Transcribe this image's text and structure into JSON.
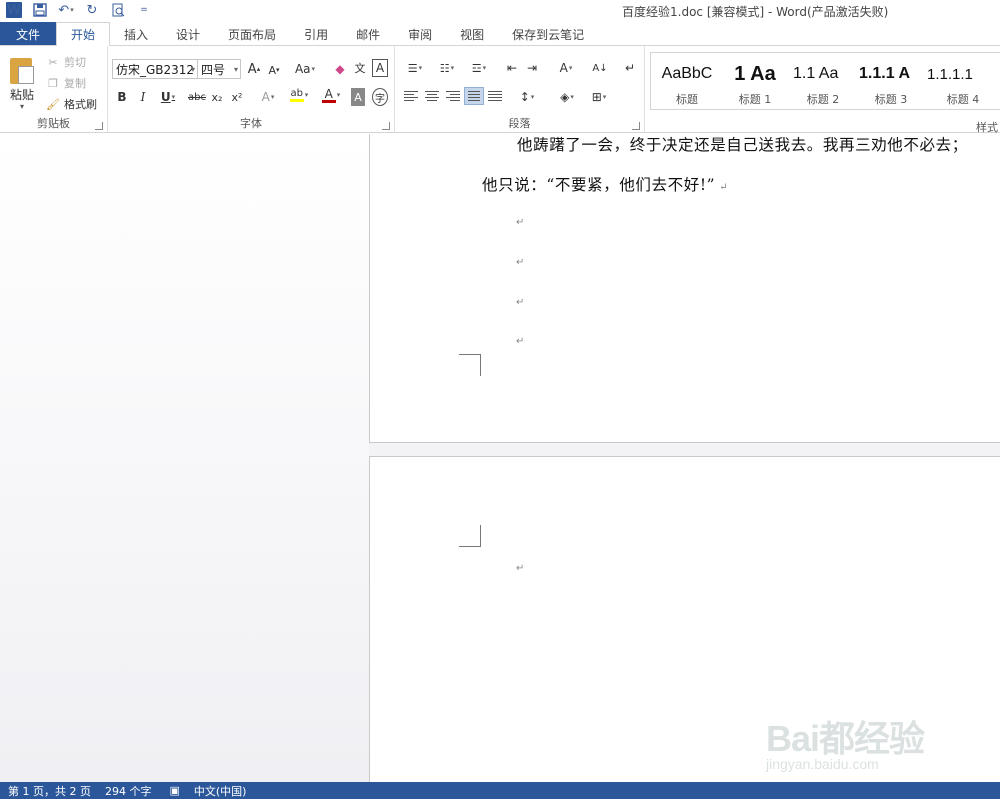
{
  "window": {
    "title": "百度经验1.doc [兼容模式] - Word(产品激活失败)"
  },
  "quick_access": {
    "icons": [
      "word-logo-icon",
      "save-icon",
      "undo-icon",
      "redo-icon",
      "print-preview-icon",
      "customize-qat-icon"
    ]
  },
  "tabs": {
    "file": "文件",
    "home": "开始",
    "insert": "插入",
    "design": "设计",
    "layout": "页面布局",
    "references": "引用",
    "mailings": "邮件",
    "review": "审阅",
    "view": "视图",
    "cloud": "保存到云笔记"
  },
  "clipboard": {
    "paste": "粘贴",
    "cut": "剪切",
    "copy": "复制",
    "format_painter": "格式刷",
    "label": "剪贴板"
  },
  "font": {
    "name": "仿宋_GB2312",
    "size": "四号",
    "bold": "B",
    "italic": "I",
    "underline": "U",
    "strike": "abc",
    "subscript": "x₂",
    "superscript": "x²",
    "grow": "A",
    "shrink": "A",
    "case": "Aa",
    "label": "字体",
    "font_color": "#c00000",
    "highlight_color": "#ffff00"
  },
  "paragraph": {
    "label": "段落"
  },
  "styles": {
    "label": "样式",
    "items": [
      {
        "preview": "AaBbC",
        "name": "标题"
      },
      {
        "preview": "1 Aa",
        "name": "标题 1"
      },
      {
        "preview": "1.1 Aa",
        "name": "标题 2"
      },
      {
        "preview": "1.1.1 A",
        "name": "标题 3"
      },
      {
        "preview": "1.1.1.1",
        "name": "标题 4"
      }
    ]
  },
  "document": {
    "line1": "他踌躇了一会，终于决定还是自己送我去。我再三劝他不必去；",
    "line2": "他只说：“不要紧，他们去不好!”",
    "paragraph_mark": "↵"
  },
  "watermark": {
    "main": "Bai都经验",
    "sub": "jingyan.baidu.com"
  },
  "status": {
    "page": "第 1 页，共 2 页",
    "words": "294 个字",
    "language": "中文(中国)"
  },
  "colors": {
    "accent": "#2b579a"
  }
}
